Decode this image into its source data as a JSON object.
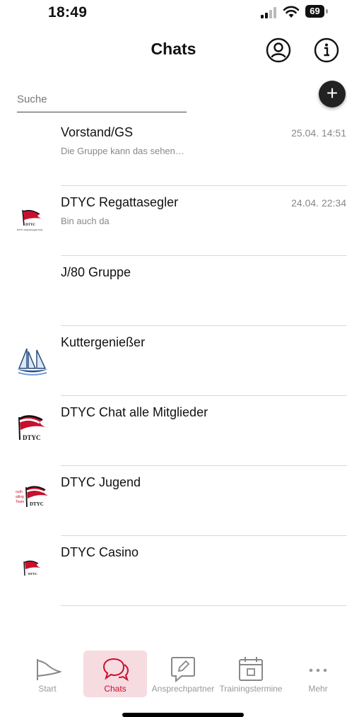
{
  "status": {
    "time": "18:49",
    "battery": "69"
  },
  "header": {
    "title": "Chats"
  },
  "search": {
    "placeholder": "Suche"
  },
  "chats": [
    {
      "name": "Vorstand/GS",
      "time": "25.04. 14:51",
      "preview": "Die Gruppe kann das sehen…",
      "avatar": "none"
    },
    {
      "name": "DTYC Regattasegler",
      "time": "24.04. 22:34",
      "preview": "Bin auch da",
      "avatar": "dtyc-flag-logo"
    },
    {
      "name": "J/80 Gruppe",
      "time": "",
      "preview": "",
      "avatar": "none"
    },
    {
      "name": "Kuttergenießer",
      "time": "",
      "preview": "",
      "avatar": "sailboat-logo"
    },
    {
      "name": "DTYC Chat alle Mitglieder",
      "time": "",
      "preview": "",
      "avatar": "dtyc-flag-logo"
    },
    {
      "name": "DTYC Jugend",
      "time": "",
      "preview": "",
      "avatar": "dtyc-flag-logo"
    },
    {
      "name": "DTYC Casino",
      "time": "",
      "preview": "",
      "avatar": "dtyc-flag-logo"
    }
  ],
  "tabs": [
    {
      "label": "Start",
      "icon": "flag-icon",
      "active": false
    },
    {
      "label": "Chats",
      "icon": "chat-bubbles-icon",
      "active": true
    },
    {
      "label": "Ansprechpartner",
      "icon": "edit-bubble-icon",
      "active": false
    },
    {
      "label": "Trainingstermine",
      "icon": "calendar-icon",
      "active": false
    },
    {
      "label": "Mehr",
      "icon": "more-dots-icon",
      "active": false
    }
  ],
  "colors": {
    "accent": "#c8102e",
    "active_tab_bg": "#f6dbe0"
  }
}
